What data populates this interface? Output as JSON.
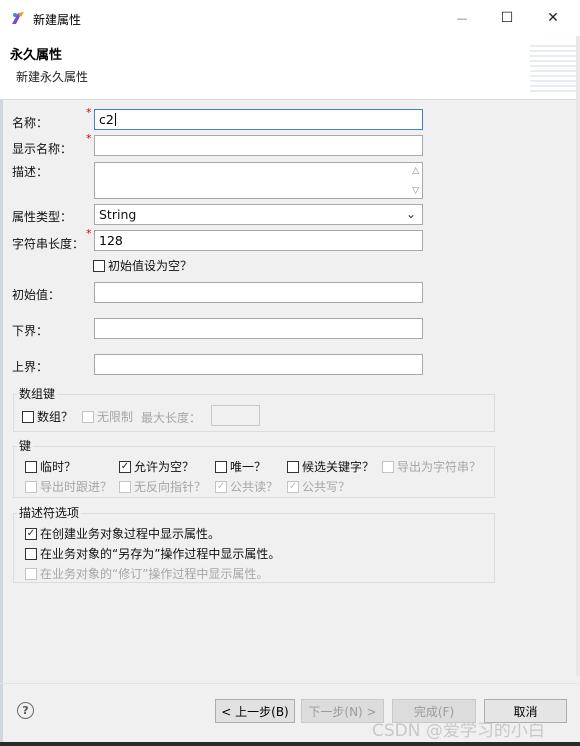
{
  "window": {
    "title": "新建属性",
    "minimize_glyph": "—",
    "maximize_glyph": "☐",
    "close_glyph": "✕"
  },
  "header": {
    "title": "永久属性",
    "subtitle": "新建永久属性"
  },
  "form": {
    "name_label": "名称：",
    "name_value": "c2",
    "display_name_label": "显示名称：",
    "display_name_value": "",
    "description_label": "描述：",
    "description_value": "",
    "type_label": "属性类型：",
    "type_value": "String",
    "strlen_label": "字符串长度：",
    "strlen_value": "128",
    "initial_null_label": "初始值设为空？",
    "initial_value_label": "初始值：",
    "lower_bound_label": "下界：",
    "upper_bound_label": "上界：",
    "required_mark": "*"
  },
  "array_group": {
    "title": "数组键",
    "array_label": "数组？",
    "unlimited_label": "无限制",
    "maxlen_label": "最大长度："
  },
  "key_group": {
    "title": "键",
    "row1": [
      {
        "label": "临时？",
        "checked": false,
        "enabled": true
      },
      {
        "label": "允许为空？",
        "checked": true,
        "enabled": true
      },
      {
        "label": "唯一？",
        "checked": false,
        "enabled": true
      },
      {
        "label": "候选关键字？",
        "checked": false,
        "enabled": true
      },
      {
        "label": "导出为字符串？",
        "checked": false,
        "enabled": false
      }
    ],
    "row2": [
      {
        "label": "导出时跟进？",
        "checked": false,
        "enabled": false
      },
      {
        "label": "无反向指针？",
        "checked": false,
        "enabled": false
      },
      {
        "label": "公共读？",
        "checked": true,
        "enabled": false
      },
      {
        "label": "公共写？",
        "checked": true,
        "enabled": false
      }
    ]
  },
  "descriptor_group": {
    "title": "描述符选项",
    "options": [
      {
        "label": "在创建业务对象过程中显示属性。",
        "checked": true,
        "enabled": true
      },
      {
        "label": "在业务对象的“另存为”操作过程中显示属性。",
        "checked": false,
        "enabled": true
      },
      {
        "label": "在业务对象的“修订”操作过程中显示属性。",
        "checked": false,
        "enabled": false
      }
    ]
  },
  "footer": {
    "help_glyph": "?",
    "back_label": "< 上一步(B)",
    "next_label": "下一步(N) >",
    "finish_label": "完成(F)",
    "cancel_label": "取消"
  },
  "watermark": "CSDN @爱学习的小白",
  "check_glyph": "✓"
}
